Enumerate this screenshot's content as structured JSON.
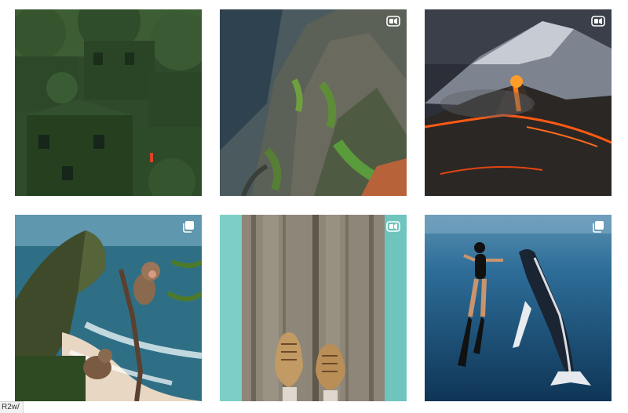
{
  "feed": {
    "posts": [
      {
        "subject": "overgrown-village",
        "badge": "none"
      },
      {
        "subject": "green-mountain-ridges",
        "badge": "reel-icon"
      },
      {
        "subject": "erupting-volcano",
        "badge": "reel-icon"
      },
      {
        "subject": "monkeys-at-coastal-cliff",
        "badge": "carousel-icon"
      },
      {
        "subject": "boots-on-wooden-plank",
        "badge": "reel-icon"
      },
      {
        "subject": "diver-and-humpback-whale",
        "badge": "carousel-icon"
      }
    ]
  },
  "status_bar": {
    "url": "R2w/"
  },
  "colors": {
    "background": "#ffffff",
    "badge": "#ffffff"
  }
}
